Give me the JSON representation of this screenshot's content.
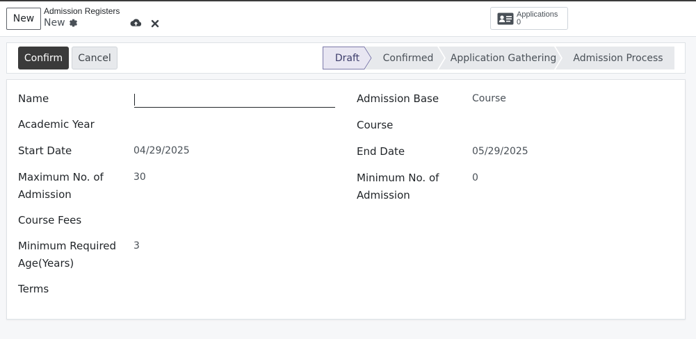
{
  "control_panel": {
    "new_button": "New",
    "breadcrumb": "Admission Registers",
    "record_name": "New",
    "icons": {
      "settings": "gear-icon",
      "save": "cloud-upload-icon",
      "discard": "close-icon"
    },
    "smart_button": {
      "label": "Applications",
      "count": "0",
      "icon": "id-card-icon"
    }
  },
  "statusbar": {
    "confirm_label": "Confirm",
    "cancel_label": "Cancel",
    "stages": [
      "Draft",
      "Confirmed",
      "Application Gathering",
      "Admission Process"
    ],
    "active_stage": "Draft",
    "colors": {
      "confirm_bg": "#3b3b3b",
      "active_stage_bg": "#e8e6f2",
      "active_stage_border": "#7a78a8",
      "stage_bg": "#e7e9ec"
    }
  },
  "form": {
    "left": {
      "name_label": "Name",
      "name_value": "",
      "academic_year_label": "Academic Year",
      "start_date_label": "Start Date",
      "start_date_value": "04/29/2025",
      "max_admission_label_1": "Maximum No. of",
      "max_admission_label_2": "Admission",
      "max_admission_value": "30",
      "course_fees_label": "Course Fees",
      "min_age_label_1": "Minimum Required",
      "min_age_label_2": "Age(Years)",
      "min_age_value": "3",
      "terms_label": "Terms"
    },
    "right": {
      "admission_base_label": "Admission Base",
      "admission_base_value": "Course",
      "course_label": "Course",
      "end_date_label": "End Date",
      "end_date_value": "05/29/2025",
      "min_admission_label_1": "Minimum No. of",
      "min_admission_label_2": "Admission",
      "min_admission_value": "0"
    }
  }
}
